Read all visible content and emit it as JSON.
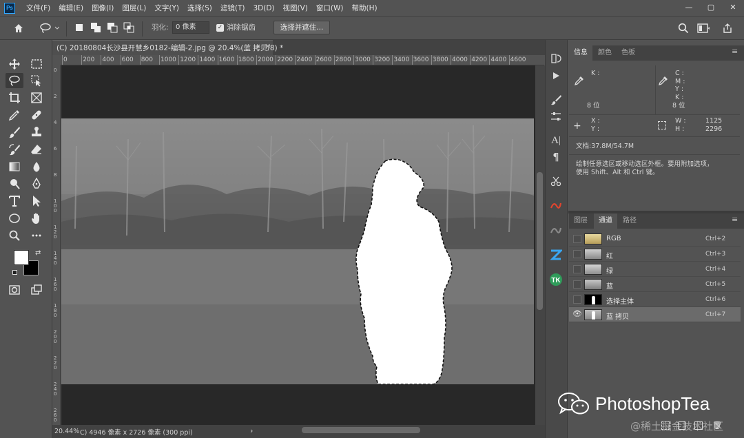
{
  "menu": [
    "文件(F)",
    "编辑(E)",
    "图像(I)",
    "图层(L)",
    "文字(Y)",
    "选择(S)",
    "滤镜(T)",
    "3D(D)",
    "视图(V)",
    "窗口(W)",
    "帮助(H)"
  ],
  "window_controls": [
    "—",
    "▢",
    "✕"
  ],
  "options": {
    "feather_label": "羽化:",
    "feather_value": "0 像素",
    "antialias_label": "消除锯齿",
    "antialias_checked": true,
    "select_mask_button": "选择并遮住..."
  },
  "tab": {
    "title": "(C) 20180804长沙县开慧乡0182-编辑-2.jpg @ 20.4%(蓝 拷贝/8) *",
    "close": "✕"
  },
  "ruler_h": [
    "0",
    "200",
    "400",
    "600",
    "800",
    "1000",
    "1200",
    "1400",
    "1600",
    "1800",
    "2000",
    "2200",
    "2400",
    "2600",
    "2800",
    "3000",
    "3200",
    "3400",
    "3600",
    "3800",
    "4000",
    "4200",
    "4400",
    "4600"
  ],
  "ruler_v": [
    "0",
    "2",
    "4",
    "6",
    "8",
    "1\n0\n0",
    "1\n2\n0",
    "1\n4\n0",
    "1\n6\n0",
    "1\n8\n0",
    "2\n0\n0",
    "2\n2\n0",
    "2\n4\n0",
    "2\n6\n0"
  ],
  "status": {
    "zoom": "20.44%",
    "doc": "C) 4946 像素 x 2726 像素 (300 ppi)",
    "arrow": "›"
  },
  "info_panel": {
    "tabs": [
      "信息",
      "颜色",
      "色板"
    ],
    "k_label": "K :",
    "bits_left": "8 位",
    "cmyk_labels": "C :\nM :\nY :\nK :",
    "bits_right": "8 位",
    "xy_labels": "X :\nY :",
    "wh_labels": "W :\nH :",
    "w_value": "1125",
    "h_value": "2296",
    "doc_size": "文档:37.8M/54.7M",
    "hint": "绘制任意选区或移动选区外框。要用附加选项，\n使用 Shift、Alt 和 Ctrl 键。"
  },
  "channels_panel": {
    "tabs": [
      "图层",
      "通道",
      "路径"
    ],
    "channels": [
      {
        "name": "RGB",
        "shortcut": "Ctrl+2",
        "visible": false,
        "selected": false
      },
      {
        "name": "红",
        "shortcut": "Ctrl+3",
        "visible": false,
        "selected": false
      },
      {
        "name": "绿",
        "shortcut": "Ctrl+4",
        "visible": false,
        "selected": false
      },
      {
        "name": "蓝",
        "shortcut": "Ctrl+5",
        "visible": false,
        "selected": false
      },
      {
        "name": "选择主体",
        "shortcut": "Ctrl+6",
        "visible": false,
        "selected": false
      },
      {
        "name": "蓝 拷贝",
        "shortcut": "Ctrl+7",
        "visible": true,
        "selected": true
      }
    ]
  },
  "watermark": {
    "brand": "PhotoshopTea",
    "site": "@稀土掘金技术社区"
  },
  "colors": {
    "ui_bg": "#535353",
    "dark_panel": "#424242",
    "canvas_bg": "#282828",
    "selected_row": "#6b6b6b"
  }
}
